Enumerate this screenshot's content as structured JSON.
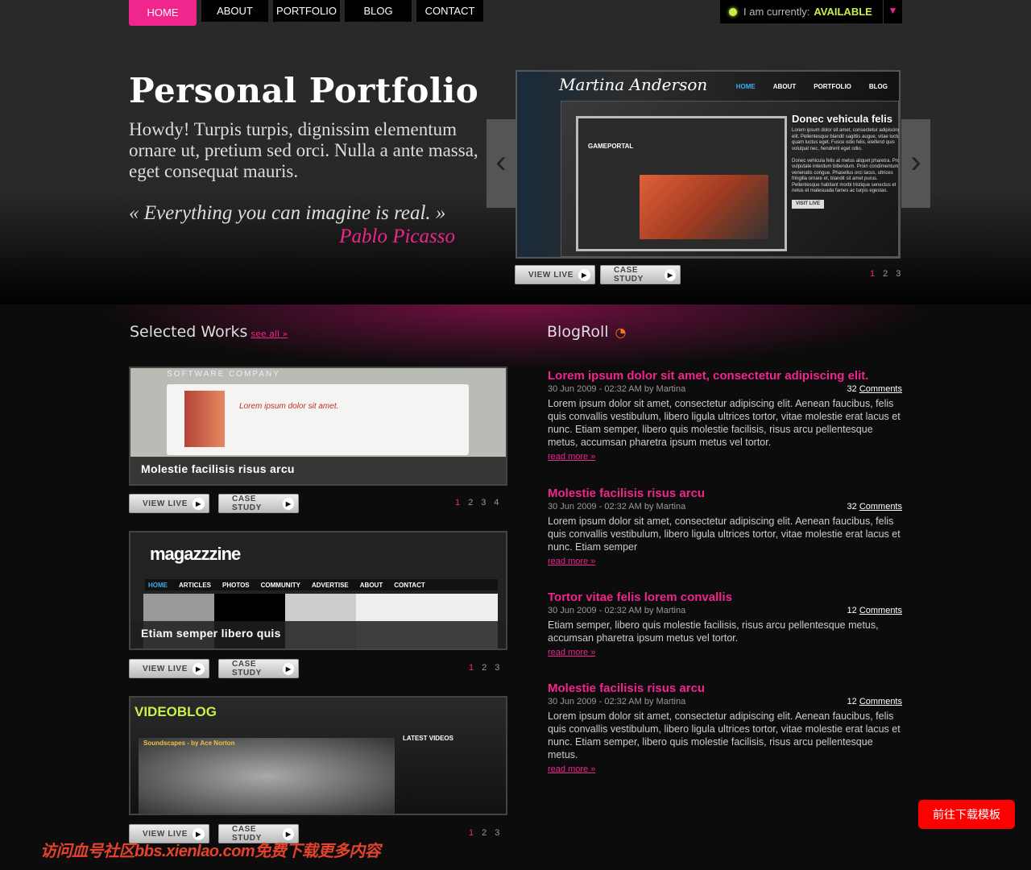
{
  "nav": {
    "items": [
      {
        "label": "HOME",
        "active": true
      },
      {
        "label": "ABOUT"
      },
      {
        "label": "PORTFOLIO"
      },
      {
        "label": "BLOG"
      },
      {
        "label": "CONTACT"
      }
    ]
  },
  "status": {
    "label": "I am currently:",
    "value": "AVAILABLE",
    "icon": "chevron-down-icon",
    "color": "#c8f04a"
  },
  "hero": {
    "title": "Personal Portfolio",
    "intro": "Howdy! Turpis turpis, dignissim elementum ornare ut, pretium sed orci. Nulla a ante massa, eget consequat mauris.",
    "quote": "« Everything you can imagine is real. »",
    "author": "Pablo Picasso"
  },
  "slider": {
    "brand": "Martina Anderson",
    "nav": [
      "HOME",
      "ABOUT",
      "PORTFOLIO",
      "BLOG"
    ],
    "mock_title": "GAMEPORTAL",
    "heading": "Donec vehicula felis",
    "text1": "Lorem ipsum dolor sit amet, consectetur adipiscing elit. Pellentesque blandit sagittis augue, vitae luctus quam luctus eget. Fusce odio felis, eleifend quis volutpat nec, hendrerit eget odio.",
    "text2": "Donec vehicula felis at metus aliquet pharetra. Proin vulputate interdum bibendum. Proin condimentum venenatis congue. Phasellus orci lacus, ultrices fringilla ornare et, blandit sit amet purus. Pellentesque habitant morbi tristique senectus et netus et malesuada fames ac turpis egestas.",
    "visit": "VISIT LIVE",
    "view_live": "VIEW LIVE",
    "case_study": "CASE STUDY",
    "pages": [
      "1",
      "2",
      "3"
    ]
  },
  "works": {
    "title": "Selected Works",
    "see_all": "see all »",
    "items": [
      {
        "caption": "Molestie facilisis risus arcu",
        "mock_logo": "SOFTWARE COMPANY",
        "mock_heading": "Lorem ipsum dolor sit amet.",
        "pages": [
          "1",
          "2",
          "3",
          "4"
        ]
      },
      {
        "caption": "Etiam semper libero quis",
        "mock_logo": "magazzzine",
        "mock_nav": [
          "HOME",
          "ARTICLES",
          "PHOTOS",
          "COMMUNITY",
          "ADVERTISE",
          "ABOUT",
          "CONTACT"
        ],
        "pages": [
          "1",
          "2",
          "3"
        ]
      },
      {
        "caption": "",
        "mock_logo": "VIDEOBLOG",
        "mock_sub": "Soundscapes - by Ace Norton",
        "mock_side": "LATEST VIDEOS",
        "pages": [
          "1",
          "2",
          "3"
        ]
      }
    ],
    "view_live": "VIEW LIVE",
    "case_study": "CASE STUDY"
  },
  "blogroll": {
    "title": "BlogRoll",
    "posts": [
      {
        "title": "Lorem ipsum dolor sit amet, consectetur adipiscing elit.",
        "meta": "30 Jun 2009 - 02:32 AM by Martina",
        "count": "32",
        "comments": "Comments",
        "body": "Lorem ipsum dolor sit amet, consectetur adipiscing elit. Aenean faucibus, felis quis convallis vestibulum, libero ligula ultrices tortor, vitae molestie erat lacus et nunc. Etiam semper, libero quis molestie facilisis, risus arcu pellentesque metus, accumsan pharetra ipsum metus vel tortor.",
        "more": "read more »"
      },
      {
        "title": "Molestie facilisis risus arcu",
        "meta": "30 Jun 2009 - 02:32 AM by Martina",
        "count": "32",
        "comments": "Comments",
        "body": "Lorem ipsum dolor sit amet, consectetur adipiscing elit. Aenean faucibus, felis quis convallis vestibulum, libero ligula ultrices tortor, vitae molestie erat lacus et nunc. Etiam semper",
        "more": "read more »"
      },
      {
        "title": "Tortor vitae felis lorem convallis",
        "meta": "30 Jun 2009 - 02:32 AM by Martina",
        "count": "12",
        "comments": "Comments",
        "body": "Etiam semper, libero quis molestie facilisis, risus arcu pellentesque metus, accumsan pharetra ipsum metus vel tortor.",
        "more": "read more »"
      },
      {
        "title": "Molestie facilisis risus arcu",
        "meta": "30 Jun 2009 - 02:32 AM by Martina",
        "count": "12",
        "comments": "Comments",
        "body": "Lorem ipsum dolor sit amet, consectetur adipiscing elit. Aenean faucibus, felis quis convallis vestibulum, libero ligula ultrices tortor, vitae molestie erat lacus et nunc. Etiam semper, libero quis molestie facilisis, risus arcu pellentesque metus.",
        "more": "read more »"
      }
    ]
  },
  "watermark": "访问血号社区bbs.xienlao.com免费下载更多内容",
  "download_button": "前往下载模板",
  "colors": {
    "accent": "#f0258e",
    "available": "#c8f04a"
  }
}
